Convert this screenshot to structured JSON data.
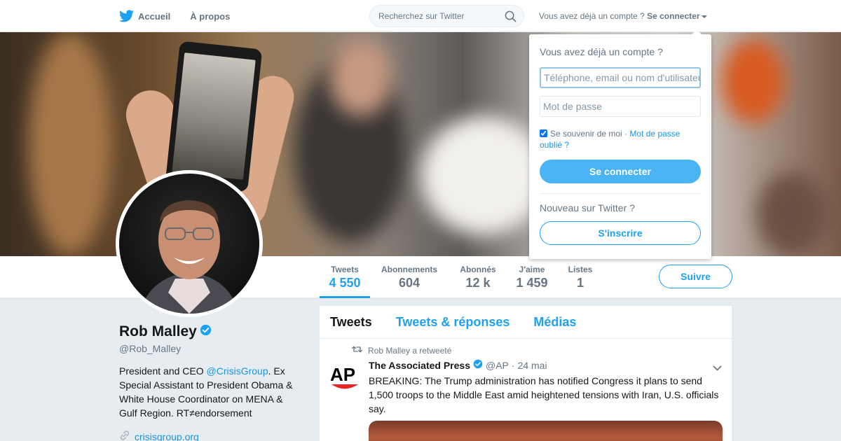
{
  "nav": {
    "home_label": "Accueil",
    "about_label": "À propos",
    "search_placeholder": "Recherchez sur Twitter",
    "account_prompt": "Vous avez déjà un compte ?",
    "login_label": "Se connecter"
  },
  "profile": {
    "name": "Rob Malley",
    "handle": "@Rob_Malley",
    "bio_before": "President and CEO ",
    "bio_mention": "@CrisisGroup",
    "bio_after": ". Ex Special Assistant to President Obama & White House Coordinator on MENA & Gulf Region. RT≠endorsement",
    "website": "crisisgroup.org",
    "verified": true
  },
  "stats": [
    {
      "label": "Tweets",
      "value": "4 550"
    },
    {
      "label": "Abonnements",
      "value": "604"
    },
    {
      "label": "Abonnés",
      "value": "12 k"
    },
    {
      "label": "J'aime",
      "value": "1 459"
    },
    {
      "label": "Listes",
      "value": "1"
    }
  ],
  "follow_label": "Suivre",
  "timeline": {
    "tabs": [
      "Tweets",
      "Tweets & réponses",
      "Médias"
    ],
    "retweet_note": "Rob Malley a retweeté",
    "tweet": {
      "author": "The Associated Press",
      "handle": "@AP",
      "separator": "·",
      "date": "24 mai",
      "text": "BREAKING: The Trump administration has notified Congress it plans to send 1,500 troops to the Middle East amid heightened tensions with Iran, U.S. officials say.",
      "logo_text": "AP"
    }
  },
  "login_dropdown": {
    "title": "Vous avez déjà un compte ?",
    "username_placeholder": "Téléphone, email ou nom d'utilisateur",
    "password_placeholder": "Mot de passe",
    "remember_label": "Se souvenir de moi",
    "remember_separator": "·",
    "forgot_label": "Mot de passe oublié ?",
    "submit_label": "Se connecter",
    "new_prompt": "Nouveau sur Twitter ?",
    "signup_label": "S'inscrire"
  },
  "colors": {
    "accent": "#1da1f2",
    "link": "#1b95e0",
    "ap_red": "#e32726"
  },
  "icons": [
    "twitter-bird-icon",
    "search-icon",
    "chevron-down-icon",
    "verified-badge-icon",
    "retweet-icon",
    "link-icon"
  ]
}
